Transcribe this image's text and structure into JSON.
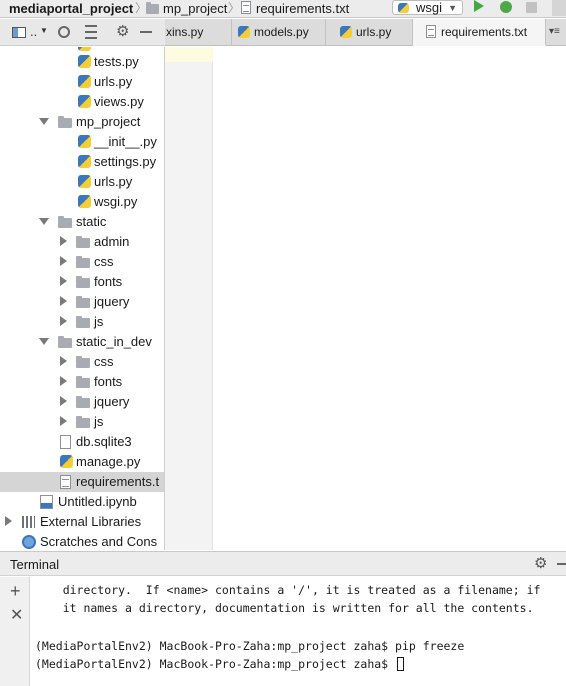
{
  "navbar": {
    "crumbs": [
      "mediaportal_project",
      "mp_project",
      "requirements.txt"
    ],
    "run_config": "wsgi"
  },
  "project_pane": {
    "view_label": "..",
    "tree": [
      {
        "label": "tests.py",
        "kind": "py"
      },
      {
        "label": "urls.py",
        "kind": "py"
      },
      {
        "label": "views.py",
        "kind": "py"
      },
      {
        "label": "mp_project",
        "kind": "folder-open"
      },
      {
        "label": "__init__.py",
        "kind": "py"
      },
      {
        "label": "settings.py",
        "kind": "py"
      },
      {
        "label": "urls.py",
        "kind": "py"
      },
      {
        "label": "wsgi.py",
        "kind": "py"
      },
      {
        "label": "static",
        "kind": "folder-open"
      },
      {
        "label": "admin",
        "kind": "folder"
      },
      {
        "label": "css",
        "kind": "folder"
      },
      {
        "label": "fonts",
        "kind": "folder"
      },
      {
        "label": "jquery",
        "kind": "folder"
      },
      {
        "label": "js",
        "kind": "folder"
      },
      {
        "label": "static_in_dev",
        "kind": "folder-open"
      },
      {
        "label": "css",
        "kind": "folder"
      },
      {
        "label": "fonts",
        "kind": "folder"
      },
      {
        "label": "jquery",
        "kind": "folder"
      },
      {
        "label": "js",
        "kind": "folder"
      },
      {
        "label": "db.sqlite3",
        "kind": "file"
      },
      {
        "label": "manage.py",
        "kind": "manage"
      },
      {
        "label": "requirements.t",
        "kind": "txt",
        "selected": true
      },
      {
        "label": "Untitled.ipynb",
        "kind": "ipynb"
      },
      {
        "label": "External Libraries",
        "kind": "lib"
      },
      {
        "label": "Scratches and Cons",
        "kind": "scratch"
      }
    ]
  },
  "tabs": [
    {
      "label": "xins.py"
    },
    {
      "label": "models.py"
    },
    {
      "label": "urls.py"
    },
    {
      "label": "requirements.txt",
      "active": true
    }
  ],
  "terminal": {
    "title": "Terminal",
    "lines": [
      "    directory.  If <name> contains a '/', it is treated as a filename; if",
      "    it names a directory, documentation is written for all the contents.",
      "",
      "(MediaPortalEnv2) MacBook-Pro-Zaha:mp_project zaha$ pip freeze",
      "(MediaPortalEnv2) MacBook-Pro-Zaha:mp_project zaha$ "
    ]
  },
  "icons": {
    "run": "play-icon",
    "debug": "bug-icon",
    "stop": "stop-icon",
    "settings": "gear-icon",
    "new_session": "plus-icon",
    "close_session": "close-icon"
  },
  "colors": {
    "run_green": "#3cac3c",
    "python_blue": "#3b77bc",
    "python_yellow": "#f4ce36",
    "selection": "#d5d5d5"
  }
}
